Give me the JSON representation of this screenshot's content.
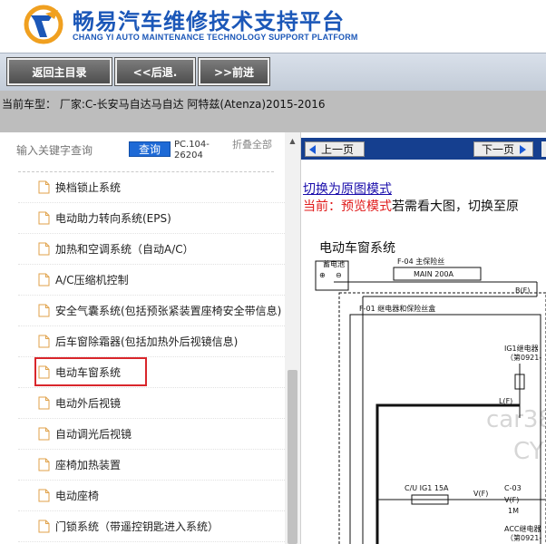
{
  "header": {
    "title": "畅易汽车维修技术支持平台",
    "subtitle": "CHANG YI AUTO MAINTENANCE TECHNOLOGY SUPPORT PLATFORM",
    "brand_color": "#1b57b8",
    "logo_icon": "chang-yi-logo-icon"
  },
  "toolbar": {
    "home_label": "返回主目录",
    "back_label": "<<后退.",
    "forward_label": ">>前进"
  },
  "vehicle": {
    "current_text": "当前车型：  厂家:C-长安马自达马自达 阿特兹(Atenza)2015-2016"
  },
  "search": {
    "placeholder": "输入关键字查询",
    "button_label": "查询",
    "code": "PC.104-26204",
    "collapse_label": "折叠全部"
  },
  "tree": {
    "items": [
      {
        "label": "换档锁止系统"
      },
      {
        "label": "电动助力转向系统(EPS)"
      },
      {
        "label": "加热和空调系统（自动A/C）"
      },
      {
        "label": "A/C压缩机控制"
      },
      {
        "label": "安全气囊系统(包括预张紧装置座椅安全带信息)"
      },
      {
        "label": "后车窗除霜器(包括加热外后视镜信息)"
      },
      {
        "label": "电动车窗系统"
      },
      {
        "label": "电动外后视镜"
      },
      {
        "label": "自动调光后视镜"
      },
      {
        "label": "座椅加热装置"
      },
      {
        "label": "电动座椅"
      },
      {
        "label": "门锁系统（带遥控钥匙进入系统）"
      }
    ],
    "selected_label": "电动车窗系统",
    "selected_color": "#d9262b"
  },
  "viewer": {
    "prev_label": "上一页",
    "next_label": "下一页",
    "switch_link": "切换为原图模式",
    "mode_prefix": "当前：预览模式",
    "mode_suffix": "若需看大图，切换至原",
    "nav_color": "#153f8f"
  },
  "diagram": {
    "title": "电动车窗系统",
    "battery": "蓄电池",
    "plus_sign": "⊕",
    "minus_sign": "⊖",
    "fuse_main_name": "F-04  主保险丝",
    "fuse_main": "MAIN 200A",
    "relay_box": "F-01  继电器和保险丝盒",
    "terminal_b": "B(F)",
    "terminal_l": "L(F)",
    "terminal_v1": "V(F)",
    "terminal_v2": "V(F)",
    "fuse_ig1": "C/U IG1 15A",
    "connector": "C-03",
    "connector_pin": "1M",
    "ig1_relay": "IG1继电器",
    "ig1_relay_sub": "（第0921-",
    "acc_relay": "ACC继电器",
    "acc_relay_sub": "（第0921-",
    "watermark_1": "car38",
    "watermark_2": "CY"
  }
}
